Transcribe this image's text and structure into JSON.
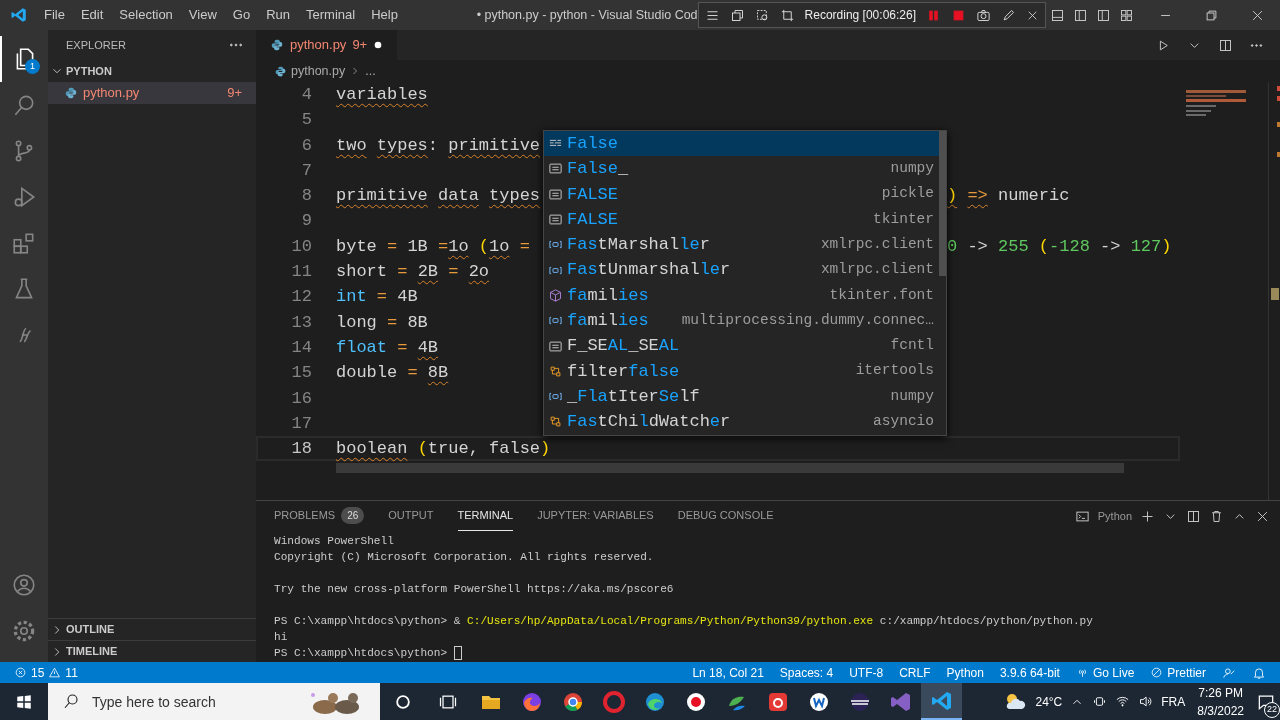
{
  "title_bar": {
    "menus": [
      "File",
      "Edit",
      "Selection",
      "View",
      "Go",
      "Run",
      "Terminal",
      "Help"
    ],
    "title": "• python.py - python - Visual Studio Cod"
  },
  "recording_toolbar": {
    "label": "Recording [00:06:26]"
  },
  "activity_bar": {
    "items": [
      {
        "kind": "files",
        "selected": true,
        "badge": "1"
      },
      {
        "kind": "search",
        "selected": false
      },
      {
        "kind": "source-control",
        "selected": false
      },
      {
        "kind": "run-debug",
        "selected": false
      },
      {
        "kind": "extensions",
        "selected": false
      },
      {
        "kind": "testing",
        "selected": false
      },
      {
        "kind": "script",
        "selected": false
      }
    ],
    "bottom": [
      {
        "kind": "account"
      },
      {
        "kind": "settings"
      }
    ]
  },
  "sidebar": {
    "title": "EXPLORER",
    "folder": {
      "label": "PYTHON",
      "expanded": true,
      "children": [
        {
          "label": "python.py",
          "badge": "9+",
          "selected": true,
          "has_errors": true
        }
      ]
    },
    "sections": [
      {
        "label": "OUTLINE",
        "expanded": false
      },
      {
        "label": "TIMELINE",
        "expanded": false
      }
    ]
  },
  "tabs": [
    {
      "label": "python.py",
      "badge": "9+",
      "selected": true,
      "modified": true,
      "has_errors": true
    }
  ],
  "breadcrumb": [
    "python.py",
    "..."
  ],
  "editor": {
    "lines": [
      {
        "number": "4",
        "current": false,
        "code": [
          {
            "t": "variables",
            "kind": "text",
            "squiggle": true
          }
        ]
      },
      {
        "number": "5",
        "current": false
      },
      {
        "number": "6",
        "current": false,
        "code": [
          {
            "t": "two",
            "kind": "text",
            "squiggle": true
          },
          {
            "t": " types",
            "kind": "text",
            "squiggle": true
          },
          {
            "t": ":",
            "kind": "text",
            "squiggle": false
          },
          {
            "t": " primitive",
            "kind": "text",
            "squiggle": true
          }
        ]
      },
      {
        "number": "7",
        "current": false
      },
      {
        "number": "8",
        "current": false,
        "code": [
          {
            "t": "primitive",
            "kind": "text",
            "squiggle": true
          },
          {
            "t": " data",
            "kind": "text",
            "squiggle": true
          },
          {
            "t": " types",
            "kind": "text",
            "squiggle": true
          }
        ],
        "tail": [
          {
            "t": ")",
            "kind": "paren",
            "squiggle": true
          },
          {
            "t": " =>",
            "kind": "op",
            "squiggle": true
          },
          {
            "t": " numeric",
            "kind": "text",
            "squiggle": false
          }
        ]
      },
      {
        "number": "9",
        "current": false
      },
      {
        "number": "10",
        "current": false,
        "code": [
          {
            "t": "byte ",
            "kind": "text",
            "squiggle": false
          },
          {
            "t": "=",
            "kind": "op",
            "squiggle": false
          },
          {
            "t": " 1B ",
            "kind": "text",
            "squiggle": false
          },
          {
            "t": "=",
            "kind": "op",
            "squiggle": false
          },
          {
            "t": "1o",
            "kind": "text",
            "squiggle": true
          },
          {
            "t": " (",
            "kind": "paren",
            "squiggle": false
          },
          {
            "t": "1o",
            "kind": "text",
            "squiggle": true
          },
          {
            "t": " =",
            "kind": "op",
            "squiggle": false
          }
        ],
        "tail": [
          {
            "t": "0",
            "kind": "num",
            "squiggle": false
          },
          {
            "t": " -> ",
            "kind": "text",
            "squiggle": false
          },
          {
            "t": "255",
            "kind": "num",
            "squiggle": false
          },
          {
            "t": " (",
            "kind": "paren",
            "squiggle": false
          },
          {
            "t": "-128",
            "kind": "num",
            "squiggle": false
          },
          {
            "t": " -> ",
            "kind": "text",
            "squiggle": false
          },
          {
            "t": "127",
            "kind": "num",
            "squiggle": false
          },
          {
            "t": ")",
            "kind": "paren",
            "squiggle": false
          }
        ]
      },
      {
        "number": "11",
        "current": false,
        "code": [
          {
            "t": "short ",
            "kind": "text",
            "squiggle": false
          },
          {
            "t": "=",
            "kind": "op",
            "squiggle": false
          },
          {
            "t": " 2B",
            "kind": "text",
            "squiggle": true
          },
          {
            "t": " =",
            "kind": "op",
            "squiggle": false
          },
          {
            "t": " 2o",
            "kind": "text",
            "squiggle": true
          }
        ]
      },
      {
        "number": "12",
        "current": false,
        "code": [
          {
            "t": "int",
            "kind": "type",
            "squiggle": false
          },
          {
            "t": " =",
            "kind": "op",
            "squiggle": false
          },
          {
            "t": " 4B",
            "kind": "text",
            "squiggle": false
          }
        ]
      },
      {
        "number": "13",
        "current": false,
        "code": [
          {
            "t": "long ",
            "kind": "text",
            "squiggle": false
          },
          {
            "t": "=",
            "kind": "op",
            "squiggle": false
          },
          {
            "t": " 8B",
            "kind": "text",
            "squiggle": false
          }
        ]
      },
      {
        "number": "14",
        "current": false,
        "code": [
          {
            "t": "float",
            "kind": "type",
            "squiggle": false
          },
          {
            "t": " =",
            "kind": "op",
            "squiggle": false
          },
          {
            "t": " 4B",
            "kind": "text",
            "squiggle": true
          }
        ]
      },
      {
        "number": "15",
        "current": false,
        "code": [
          {
            "t": "double ",
            "kind": "text",
            "squiggle": false
          },
          {
            "t": "=",
            "kind": "op",
            "squiggle": false
          },
          {
            "t": " 8B",
            "kind": "text",
            "squiggle": true
          }
        ]
      },
      {
        "number": "16",
        "current": false
      },
      {
        "number": "17",
        "current": false
      },
      {
        "number": "18",
        "current": true,
        "code": [
          {
            "t": "boolean",
            "kind": "text",
            "squiggle": true
          },
          {
            "t": " (",
            "kind": "paren",
            "squiggle": false
          },
          {
            "t": "true, false",
            "kind": "text",
            "squiggle": false
          },
          {
            "t": ")",
            "kind": "paren",
            "squiggle": false
          }
        ]
      }
    ]
  },
  "suggestions": [
    {
      "kind": "keyword",
      "selected": true,
      "label": [
        {
          "t": "False",
          "m": true
        }
      ]
    },
    {
      "kind": "constant",
      "selected": false,
      "label": [
        {
          "t": "False",
          "m": true
        },
        {
          "t": "_",
          "m": false
        }
      ],
      "detail": "numpy"
    },
    {
      "kind": "constant",
      "selected": false,
      "label": [
        {
          "t": "FALSE",
          "m": true
        }
      ],
      "detail": "pickle"
    },
    {
      "kind": "constant",
      "selected": false,
      "label": [
        {
          "t": "FALSE",
          "m": true
        }
      ],
      "detail": "tkinter"
    },
    {
      "kind": "variable",
      "selected": false,
      "label": [
        {
          "t": "Fas",
          "m": true
        },
        {
          "t": "tMarshal",
          "m": false
        },
        {
          "t": "le",
          "m": true
        },
        {
          "t": "r",
          "m": false
        }
      ],
      "detail": "xmlrpc.client"
    },
    {
      "kind": "variable",
      "selected": false,
      "label": [
        {
          "t": "Fas",
          "m": true
        },
        {
          "t": "tUnmarshal",
          "m": false
        },
        {
          "t": "le",
          "m": true
        },
        {
          "t": "r",
          "m": false
        }
      ],
      "detail": "xmlrpc.client"
    },
    {
      "kind": "module",
      "selected": false,
      "label": [
        {
          "t": "fa",
          "m": true
        },
        {
          "t": "mil",
          "m": false
        },
        {
          "t": "ies",
          "m": true
        }
      ],
      "detail": "tkinter.font"
    },
    {
      "kind": "variable",
      "selected": false,
      "label": [
        {
          "t": "fa",
          "m": true
        },
        {
          "t": "mil",
          "m": false
        },
        {
          "t": "ies",
          "m": true
        }
      ],
      "detail": "multiprocessing.dummy.connec…"
    },
    {
      "kind": "constant",
      "selected": false,
      "label": [
        {
          "t": "F_SE",
          "m": false
        },
        {
          "t": "AL",
          "m": true
        },
        {
          "t": "_SE",
          "m": false
        },
        {
          "t": "AL",
          "m": true
        }
      ],
      "detail": "fcntl"
    },
    {
      "kind": "class",
      "selected": false,
      "label": [
        {
          "t": "filter",
          "m": false
        },
        {
          "t": "false",
          "m": true
        }
      ],
      "detail": "itertools"
    },
    {
      "kind": "variable",
      "selected": false,
      "label": [
        {
          "t": "_",
          "m": false
        },
        {
          "t": "Fla",
          "m": true
        },
        {
          "t": "tIter",
          "m": false
        },
        {
          "t": "Se",
          "m": true
        },
        {
          "t": "lf",
          "m": false
        }
      ],
      "detail": "numpy"
    },
    {
      "kind": "class",
      "selected": false,
      "label": [
        {
          "t": "Fas",
          "m": true
        },
        {
          "t": "tChi",
          "m": false
        },
        {
          "t": "l",
          "m": true
        },
        {
          "t": "dWatch",
          "m": false
        },
        {
          "t": "e",
          "m": true
        },
        {
          "t": "r",
          "m": false
        }
      ],
      "detail": "asyncio"
    }
  ],
  "panel": {
    "tabs": [
      {
        "label": "PROBLEMS",
        "badge": "26",
        "selected": false
      },
      {
        "label": "OUTPUT",
        "selected": false
      },
      {
        "label": "TERMINAL",
        "selected": true
      },
      {
        "label": "JUPYTER: VARIABLES",
        "selected": false
      },
      {
        "label": "DEBUG CONSOLE",
        "selected": false
      }
    ],
    "terminal_name": "Python",
    "terminal_blocks": [
      [
        [
          {
            "t": "Windows PowerShell",
            "h": false
          }
        ],
        [
          {
            "t": "Copyright (C) Microsoft Corporation. All rights reserved.",
            "h": false
          }
        ]
      ],
      [
        [
          {
            "t": "Try the new cross-platform PowerShell https://aka.ms/pscore6",
            "h": false
          }
        ]
      ],
      [
        [
          {
            "t": "PS C:\\xampp\\htdocs\\python> & ",
            "h": false
          },
          {
            "t": "C:/Users/hp/AppData/Local/Programs/Python/Python39/python.exe",
            "h": true
          },
          {
            "t": " c:/xampp/htdocs/python/python.py",
            "h": false
          }
        ],
        [
          {
            "t": "hi",
            "h": false
          }
        ],
        [
          {
            "t": "PS C:\\xampp\\htdocs\\python>",
            "h": false
          }
        ]
      ]
    ],
    "cursor": true
  },
  "status_bar": {
    "errors": "15",
    "warnings": "11",
    "items": [
      {
        "kind": "text",
        "text": "Ln 18, Col 21"
      },
      {
        "kind": "text",
        "text": "Spaces: 4"
      },
      {
        "kind": "text",
        "text": "UTF-8"
      },
      {
        "kind": "text",
        "text": "CRLF"
      },
      {
        "kind": "text",
        "text": "Python"
      },
      {
        "kind": "text",
        "text": "3.9.6 64-bit"
      },
      {
        "kind": "live",
        "text": "Go Live"
      },
      {
        "kind": "formatter",
        "text": "Prettier"
      },
      {
        "kind": "feedback"
      },
      {
        "kind": "bell"
      }
    ]
  },
  "taskbar": {
    "search": {
      "placeholder": "Type here to search"
    },
    "apps": [
      {
        "kind": "folder",
        "selected": false
      },
      {
        "kind": "fox",
        "selected": false
      },
      {
        "kind": "tricolor-ring",
        "selected": false
      },
      {
        "kind": "red-ring",
        "selected": false
      },
      {
        "kind": "wave",
        "selected": false
      },
      {
        "kind": "record",
        "selected": false
      },
      {
        "kind": "leaves",
        "selected": false
      },
      {
        "kind": "camera",
        "selected": false
      },
      {
        "kind": "w-badge",
        "selected": false
      },
      {
        "kind": "orb",
        "selected": false
      },
      {
        "kind": "purple-ribbon",
        "selected": false
      },
      {
        "kind": "blue-ribbon",
        "selected": true
      }
    ],
    "weather": "24°C",
    "language": "FRA",
    "time": "7:26 PM",
    "date": "8/3/2022",
    "notifications": "22"
  }
}
